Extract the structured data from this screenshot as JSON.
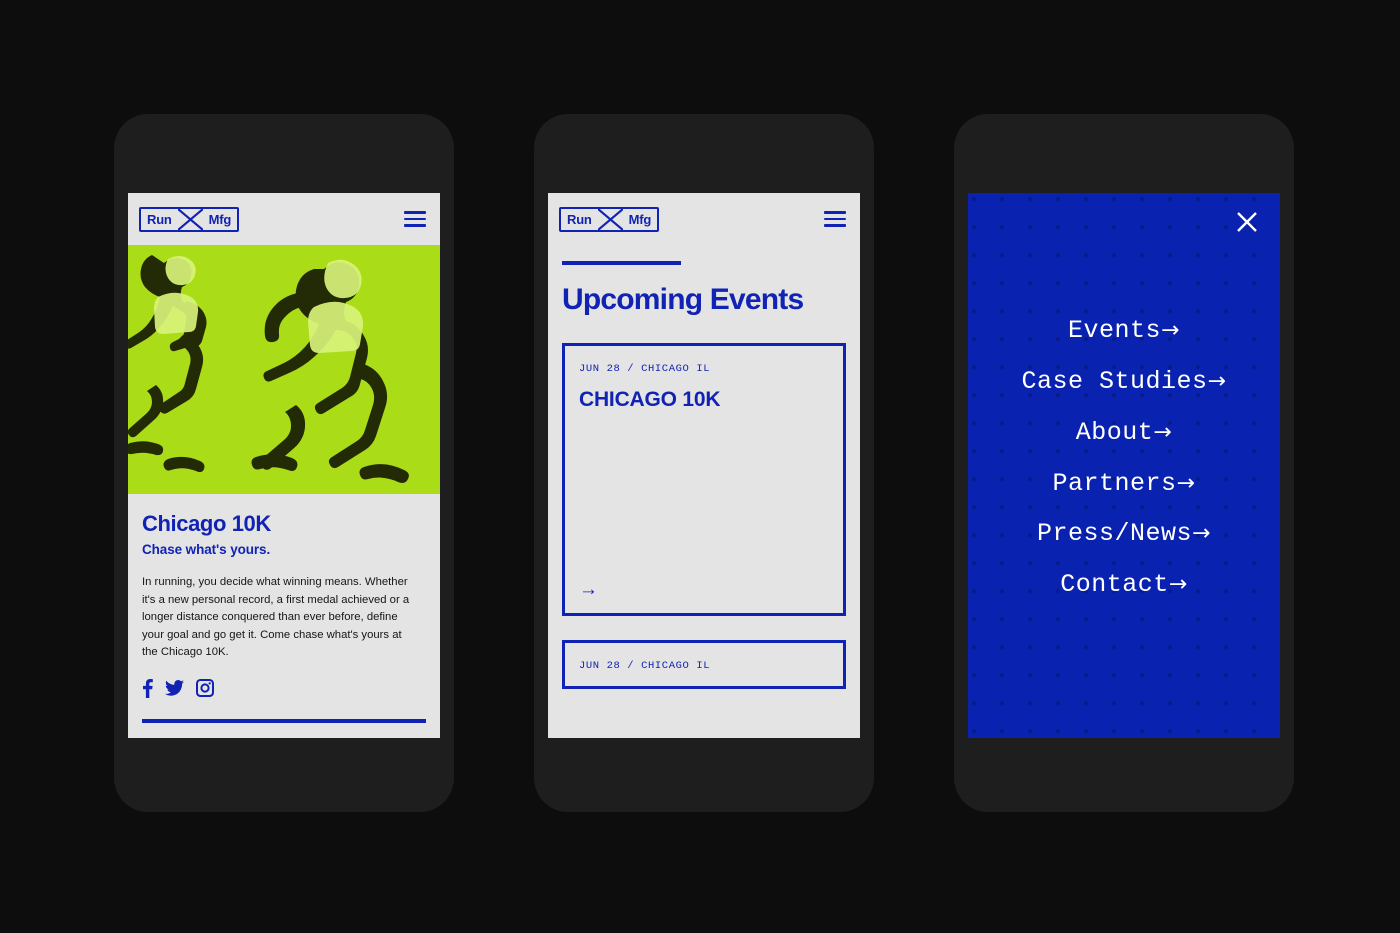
{
  "colors": {
    "brand_blue": "#1123b5",
    "menu_blue": "#0a22b0",
    "lime": "#aadd18",
    "screen_bg": "#e4e4e4",
    "frame": "#1e1e1e",
    "page_bg": "#0d0d0d"
  },
  "brand": {
    "logo_left": "Run",
    "logo_right": "Mfg"
  },
  "phone1": {
    "topbar": {
      "menu_icon": "hamburger-icon"
    },
    "hero": {
      "alt": "two-runners-duotone-lime"
    },
    "article": {
      "title": "Chicago 10K",
      "subtitle": "Chase what's yours.",
      "body": "In running, you decide what winning means. Whether it's a new personal record, a first medal achieved or a longer distance conquered than ever before, define your goal and go get it. Come chase what's yours at the Chicago 10K.",
      "socials": [
        {
          "name": "facebook-icon",
          "label": "Facebook"
        },
        {
          "name": "twitter-icon",
          "label": "Twitter"
        },
        {
          "name": "instagram-icon",
          "label": "Instagram"
        }
      ]
    }
  },
  "phone2": {
    "topbar": {
      "menu_icon": "hamburger-icon"
    },
    "title": "Upcoming Events",
    "cards": [
      {
        "meta": "JUN 28 / CHICAGO IL",
        "name": "CHICAGO 10K",
        "arrow": "→"
      },
      {
        "meta": "JUN 28 / CHICAGO IL",
        "name": "",
        "arrow": "→"
      }
    ]
  },
  "phone3": {
    "close_label": "✕",
    "menu_items": [
      {
        "label": "Events",
        "arrow": "→"
      },
      {
        "label": "Case Studies",
        "arrow": "→"
      },
      {
        "label": "About",
        "arrow": "→"
      },
      {
        "label": "Partners",
        "arrow": "→"
      },
      {
        "label": "Press/News",
        "arrow": "→"
      },
      {
        "label": "Contact",
        "arrow": "→"
      }
    ]
  }
}
